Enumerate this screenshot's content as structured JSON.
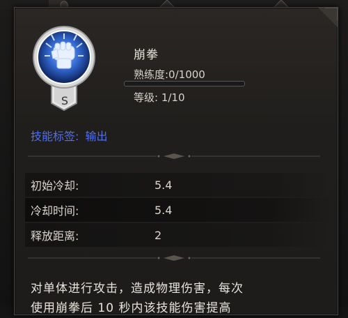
{
  "skill": {
    "name": "崩拳",
    "grade": "S",
    "mastery_text": "熟练度:0/1000",
    "mastery_progress": 0.0,
    "level_text": "等级: 1/10",
    "icon": "fist-icon"
  },
  "tags": {
    "label": "技能标签:",
    "value": "输出"
  },
  "stats": [
    {
      "label": "初始冷却:",
      "value": "5.4"
    },
    {
      "label": "冷却时间:",
      "value": "5.4"
    },
    {
      "label": "释放距离:",
      "value": "2"
    }
  ],
  "description": {
    "line1": "对单体进行攻击，造成物理伤害，每次",
    "line2": "使用崩拳后 10 秒内该技能伤害提高"
  },
  "colors": {
    "tag_blue": "#4f6ff0",
    "emblem_blue": "#2f63c8",
    "text": "#dcd7ce"
  }
}
